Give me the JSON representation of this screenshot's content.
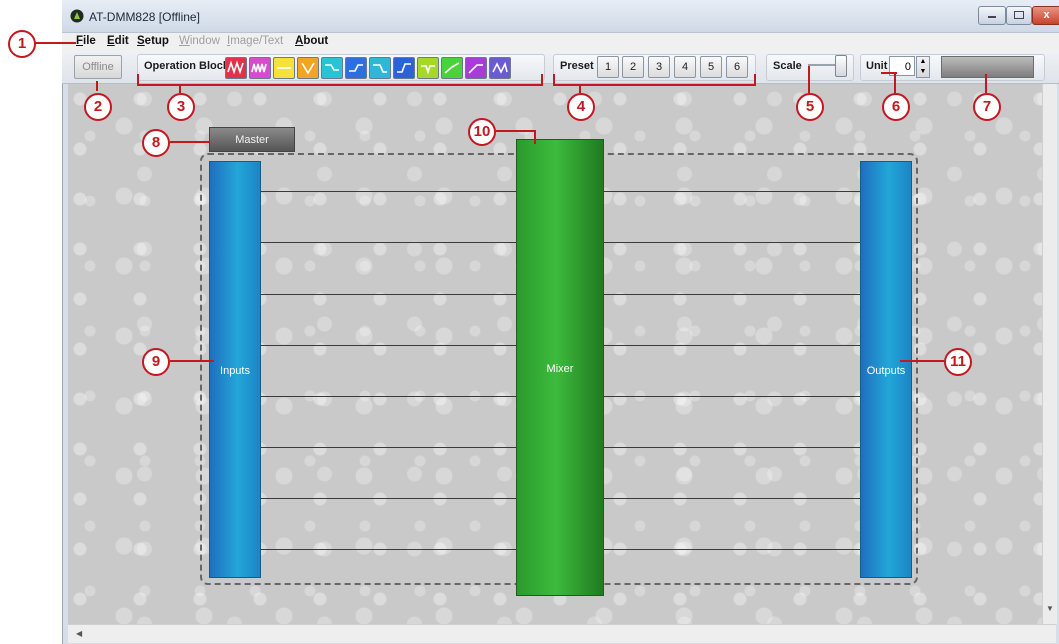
{
  "window": {
    "title": "AT-DMM828 [Offline]",
    "close_symbol": "x"
  },
  "menu": {
    "items": [
      {
        "label": "File",
        "enabled": true
      },
      {
        "label": "Edit",
        "enabled": true
      },
      {
        "label": "Setup",
        "enabled": true
      },
      {
        "label": "Window",
        "enabled": false
      },
      {
        "label": "Image/Text",
        "enabled": false
      },
      {
        "label": "About",
        "enabled": true
      }
    ]
  },
  "toolbar": {
    "offline_button": "Offline",
    "operation_block_label": "Operation Block",
    "operation_blocks": [
      {
        "icon": "parametric-eq-icon",
        "color": "#e0324a"
      },
      {
        "icon": "graphic-eq-icon",
        "color": "#d64bd0"
      },
      {
        "icon": "gain-icon",
        "color": "#f4e23a"
      },
      {
        "icon": "delay-icon",
        "color": "#f2a524"
      },
      {
        "icon": "high-shelf-icon",
        "color": "#27c4d6"
      },
      {
        "icon": "low-shelf-icon",
        "color": "#2d6fe0"
      },
      {
        "icon": "hpf-icon",
        "color": "#2db8d8"
      },
      {
        "icon": "lpf-icon",
        "color": "#2b62d8"
      },
      {
        "icon": "notch-icon",
        "color": "#a6d82b"
      },
      {
        "icon": "compressor-icon",
        "color": "#4ad23d"
      },
      {
        "icon": "limiter-icon",
        "color": "#a93bd8"
      },
      {
        "icon": "ducker-icon",
        "color": "#6a5bd4"
      }
    ],
    "preset_label": "Preset",
    "preset_buttons": [
      "1",
      "2",
      "3",
      "4",
      "5",
      "6"
    ],
    "scale_label": "Scale",
    "unit_label": "Unit",
    "unit_value": "0"
  },
  "canvas": {
    "master_tab": "Master",
    "inputs_label": "Inputs",
    "mixer_label": "Mixer",
    "outputs_label": "Outputs",
    "input_channel_count": 8,
    "output_channel_count": 8
  },
  "callouts": [
    "1",
    "2",
    "3",
    "4",
    "5",
    "6",
    "7",
    "8",
    "9",
    "10",
    "11"
  ],
  "colors": {
    "callout_red": "#c4171f",
    "io_blue": "#23a6d8",
    "mixer_green": "#3dbb3d"
  }
}
